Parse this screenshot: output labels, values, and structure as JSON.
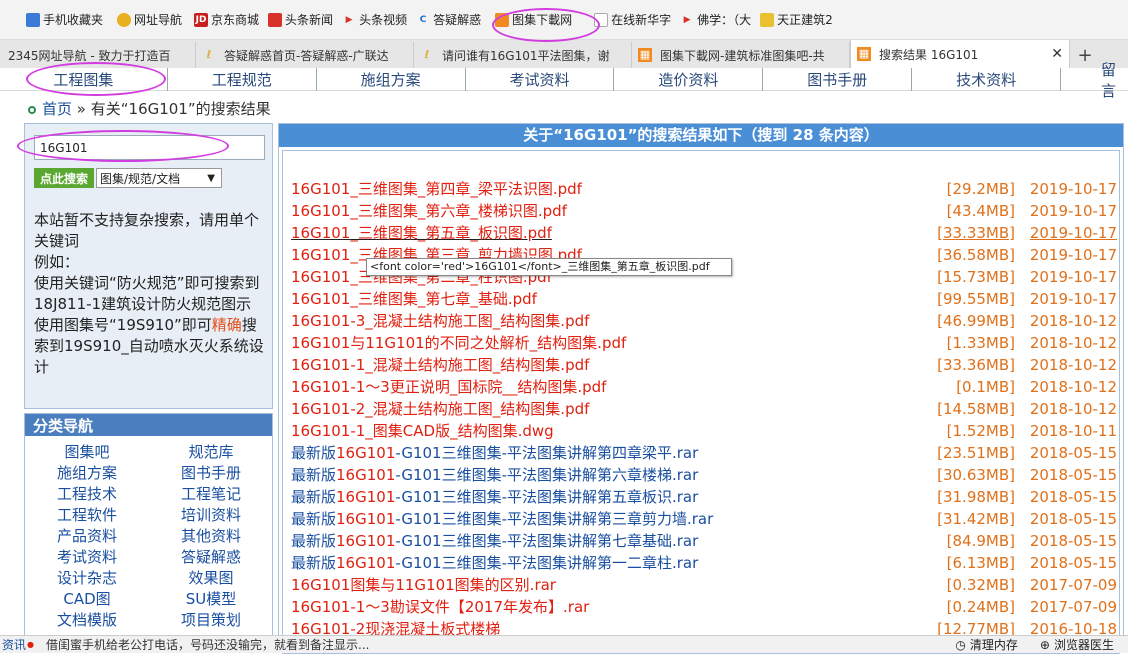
{
  "bookmarks": [
    {
      "label": "手机收藏夹",
      "icon": "phone-icon"
    },
    {
      "label": "网址导航",
      "icon": "globe-icon"
    },
    {
      "label": "京东商城",
      "icon": "jd-icon"
    },
    {
      "label": "头条新闻",
      "icon": "news-icon"
    },
    {
      "label": "头条视频",
      "icon": "video-icon"
    },
    {
      "label": "答疑解惑",
      "icon": "qa-icon"
    },
    {
      "label": "图集下載网",
      "icon": "tuji-icon"
    },
    {
      "label": "在线新华字",
      "icon": "doc-icon"
    },
    {
      "label": "佛学：（大",
      "icon": "play-icon"
    },
    {
      "label": "天正建筑2",
      "icon": "folder-icon"
    }
  ],
  "tabs": [
    {
      "label": "2345网址导航 - 致力于打造百"
    },
    {
      "label": "答疑解惑首页-答疑解惑-广联达"
    },
    {
      "label": "请问谁有16G101平法图集，谢"
    },
    {
      "label": "图集下載网-建筑标准图集吧-共"
    },
    {
      "label": "搜索结果 16G101"
    }
  ],
  "nav": [
    "工程图集",
    "工程规范",
    "施组方案",
    "考试资料",
    "造价资料",
    "图书手册",
    "技术资料",
    "留言"
  ],
  "breadcrumb": {
    "home": "首页",
    "sep": "»",
    "text": "有关“16G101”的搜索结果"
  },
  "search": {
    "value": "16G101",
    "button": "点此搜索",
    "category": "图集/规范/文档"
  },
  "tips": {
    "l1": "本站暂不支持复杂搜索，请用单个关键词",
    "l2": "例如：",
    "l3": "使用关键词“防火规范”即可搜索到18J811-1建筑设计防火规范图示",
    "l4a": "使用图集号“19S910”即可",
    "l4b": "精确",
    "l4c": "搜索到19S910_自动喷水灭火系统设计"
  },
  "category_nav": {
    "title": "分类导航",
    "items": [
      "图集吧",
      "规范库",
      "施组方案",
      "图书手册",
      "工程技术",
      "工程笔记",
      "工程软件",
      "培训资料",
      "产品资料",
      "其他资料",
      "考试资料",
      "答疑解惑",
      "设计杂志",
      "效果图",
      "CAD图",
      "SU模型",
      "文档模版",
      "项目策划"
    ]
  },
  "results_header": "关于“16G101”的搜索结果如下（搜到 28 条内容）",
  "results": [
    {
      "pre": "",
      "hl": "16G101",
      "name": "_三维图集_第四章_梁平法识图.pdf",
      "size": "[29.2MB]",
      "date": "2019-10-17"
    },
    {
      "pre": "",
      "hl": "16G101",
      "name": "_三维图集_第六章_楼梯识图.pdf",
      "size": "[43.4MB]",
      "date": "2019-10-17"
    },
    {
      "pre": "",
      "hl": "16G101",
      "name": "_三维图集_第五章_板识图.pdf",
      "size": "[33.33MB]",
      "date": "2019-10-17"
    },
    {
      "pre": "",
      "hl": "16G101",
      "name": "_三维图集_第三章_剪力墙识图.pdf",
      "size": "[36.58MB]",
      "date": "2019-10-17"
    },
    {
      "pre": "",
      "hl": "16G101",
      "name": "_三维图集_第二章_柱识图.pdf",
      "size": "[15.73MB]",
      "date": "2019-10-17"
    },
    {
      "pre": "",
      "hl": "16G101",
      "name": "_三维图集_第七章_基础.pdf",
      "size": "[99.55MB]",
      "date": "2019-10-17"
    },
    {
      "pre": "",
      "hl": "16G101",
      "name": "-3_混凝土结构施工图_结构图集.pdf",
      "size": "[46.99MB]",
      "date": "2018-10-12"
    },
    {
      "pre": "",
      "hl": "16G101",
      "name": "与11G101的不同之处解析_结构图集.pdf",
      "size": "[1.33MB]",
      "date": "2018-10-12"
    },
    {
      "pre": "",
      "hl": "16G101",
      "name": "-1_混凝土结构施工图_结构图集.pdf",
      "size": "[33.36MB]",
      "date": "2018-10-12"
    },
    {
      "pre": "",
      "hl": "16G101",
      "name": "-1～3更正说明_国标院__结构图集.pdf",
      "size": "[0.1MB]",
      "date": "2018-10-12"
    },
    {
      "pre": "",
      "hl": "16G101",
      "name": "-2_混凝土结构施工图_结构图集.pdf",
      "size": "[14.58MB]",
      "date": "2018-10-12"
    },
    {
      "pre": "",
      "hl": "16G101",
      "name": "-1_图集CAD版_结构图集.dwg",
      "size": "[1.52MB]",
      "date": "2018-10-11"
    },
    {
      "pre": "最新版",
      "hl": "16G101",
      "name": "-G101三维图集-平法图集讲解第四章梁平.rar",
      "size": "[23.51MB]",
      "date": "2018-05-15"
    },
    {
      "pre": "最新版",
      "hl": "16G101",
      "name": "-G101三维图集-平法图集讲解第六章楼梯.rar",
      "size": "[30.63MB]",
      "date": "2018-05-15"
    },
    {
      "pre": "最新版",
      "hl": "16G101",
      "name": "-G101三维图集-平法图集讲解第五章板识.rar",
      "size": "[31.98MB]",
      "date": "2018-05-15"
    },
    {
      "pre": "最新版",
      "hl": "16G101",
      "name": "-G101三维图集-平法图集讲解第三章剪力墙.rar",
      "size": "[31.42MB]",
      "date": "2018-05-15"
    },
    {
      "pre": "最新版",
      "hl": "16G101",
      "name": "-G101三维图集-平法图集讲解第七章基础.rar",
      "size": "[84.9MB]",
      "date": "2018-05-15"
    },
    {
      "pre": "最新版",
      "hl": "16G101",
      "name": "-G101三维图集-平法图集讲解第一二章柱.rar",
      "size": "[6.13MB]",
      "date": "2018-05-15"
    },
    {
      "pre": "",
      "hl": "16G101",
      "name": "图集与11G101图集的区别.rar",
      "size": "[0.32MB]",
      "date": "2017-07-09"
    },
    {
      "pre": "",
      "hl": "16G101",
      "name": "-1～3勘误文件【2017年发布】.rar",
      "size": "[0.24MB]",
      "date": "2017-07-09"
    },
    {
      "pre": "",
      "hl": "16G101",
      "name": "-2现浇混凝土板式楼梯",
      "size": "[12.77MB]",
      "date": "2016-10-18"
    }
  ],
  "tooltip": "<font color='red'>16G101</font>_三维图集_第五章_板识图.pdf",
  "status": {
    "left": "资讯",
    "msg": "借闺蜜手机给老公打电话，号码还没输完，就看到备注显示...",
    "mem": "清理内存",
    "doctor": "浏览器医生"
  },
  "colors": {
    "highlight": "#e02010",
    "link": "#1a4fa0",
    "size": "#e0701a",
    "header": "#4a8fd6",
    "annotation": "#d23de0"
  }
}
